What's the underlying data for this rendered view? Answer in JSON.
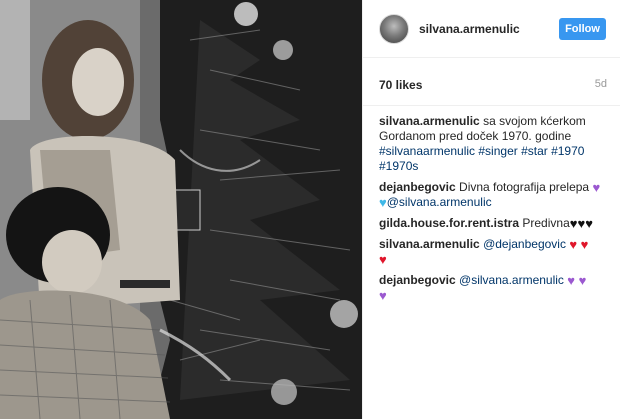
{
  "post": {
    "username": "silvana.armenulic",
    "follow_label": "Follow",
    "likes": "70 likes",
    "time": "5d"
  },
  "caption": {
    "user": "silvana.armenulic",
    "text": "sa svojom kćerkom Gordanom pred doček 1970. godine",
    "hashtags": "#silvanaarmenulic #singer #star #1970 #1970s"
  },
  "comments": [
    {
      "user": "dejanbegovic",
      "text": "Divna fotografija prelepa",
      "hearts1": "♥",
      "hearts1_color": "#9b59d0",
      "hearts2": "♥",
      "hearts2_color": "#3fb8e8",
      "mention": "@silvana.armenulic"
    },
    {
      "user": "gilda.house.for.rent.istra",
      "text": "Predivna",
      "hearts": "♥♥♥",
      "hearts_color": "#111111"
    },
    {
      "user": "silvana.armenulic",
      "mention": "@dejanbegovic",
      "hearts": "♥ ♥",
      "hearts_color": "#e0162b",
      "hearts_line2": "♥"
    },
    {
      "user": "dejanbegovic",
      "mention": "@silvana.armenulic",
      "hearts": "♥ ♥",
      "hearts_color": "#9b59d0",
      "hearts_line2": "♥"
    }
  ],
  "icons": {
    "avatar": "avatar-photo",
    "heart": "heart-icon"
  }
}
